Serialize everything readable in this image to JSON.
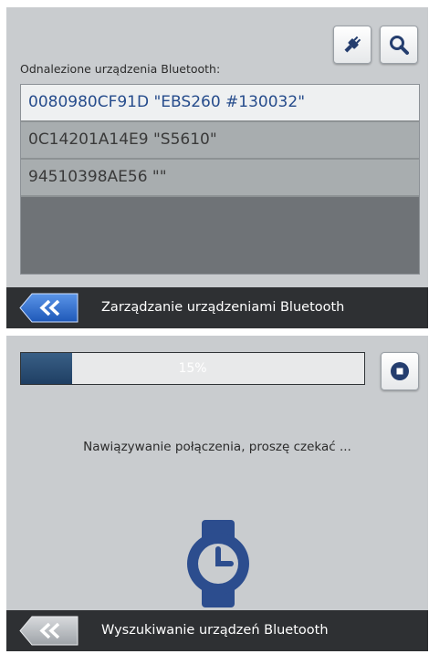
{
  "device_screen": {
    "found_label": "Odnalezione urządzenia Bluetooth:",
    "devices": [
      {
        "label": "0080980CF91D \"EBS260 #130032\"",
        "selected": true
      },
      {
        "label": "0C14201A14E9 \"S5610\"",
        "selected": false
      },
      {
        "label": "94510398AE56 \"\"",
        "selected": false
      }
    ],
    "connect_icon": "plug-icon",
    "search_icon": "search-icon",
    "bar_title": "Zarządzanie urządzeniami Bluetooth"
  },
  "connect_screen": {
    "progress": {
      "value": 0.15,
      "text": "15%"
    },
    "stop_icon": "stop-icon",
    "message": "Nawiązywanie połączenia, proszę czekać ...",
    "device_icon": "watch-icon",
    "bar_title": "Wyszukiwanie urządzeń Bluetooth"
  },
  "colors": {
    "accent": "#264c8c",
    "panel": "#c9cccf",
    "bar": "#2e3033",
    "back_button": "#2f6fd0"
  }
}
